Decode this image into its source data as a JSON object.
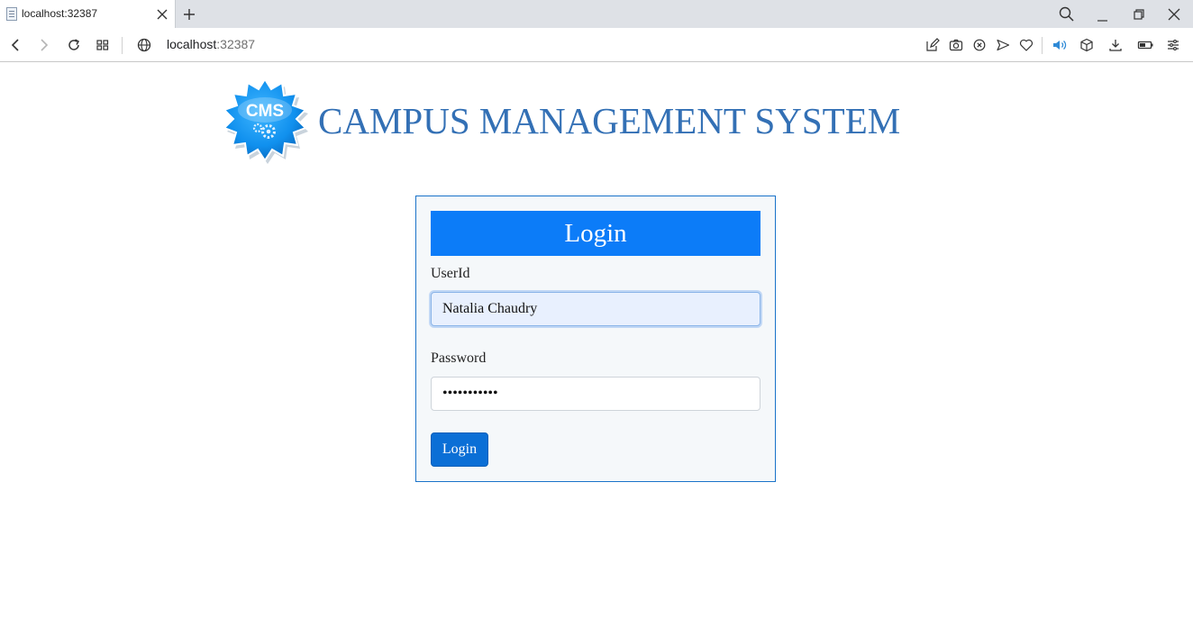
{
  "browser": {
    "tab_title": "localhost:32387",
    "address_host": "localhost",
    "address_port": ":32387"
  },
  "header": {
    "logo_text": "CMS",
    "title": "CAMPUS MANAGEMENT SYSTEM"
  },
  "login": {
    "heading": "Login",
    "userid_label": "UserId",
    "userid_value": "Natalia Chaudry",
    "password_label": "Password",
    "password_value": "•••••••••••",
    "button_label": "Login"
  },
  "colors": {
    "accent": "#0c7cf8",
    "title": "#3370b5",
    "button": "#0b6fd6",
    "box_border": "#1a73c9"
  },
  "icons": {
    "back": "arrow-left-icon",
    "forward": "arrow-right-icon",
    "reload": "reload-icon",
    "speed_dial": "grid-icon",
    "site_info": "globe-icon",
    "search": "search-icon"
  }
}
